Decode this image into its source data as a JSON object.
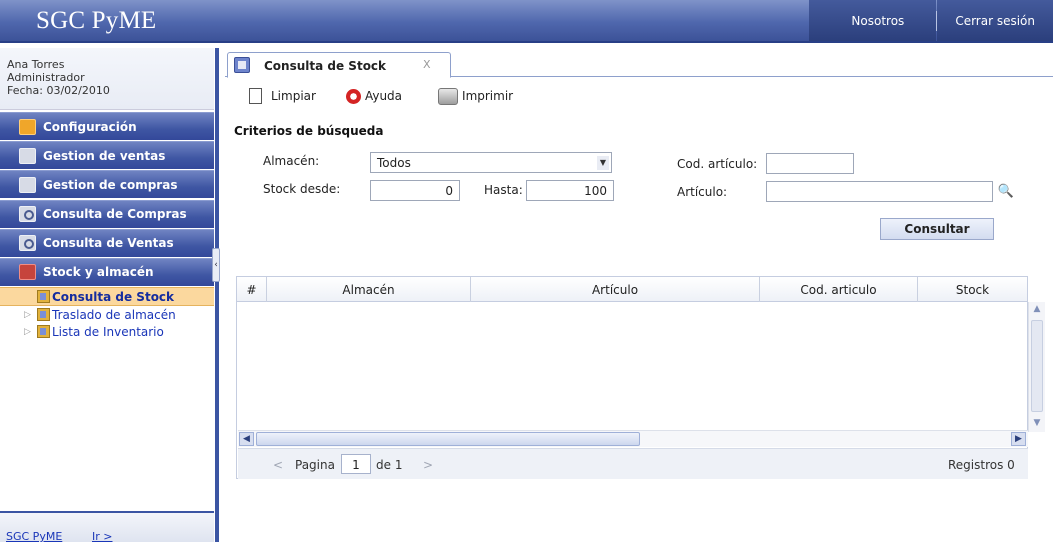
{
  "header": {
    "app_title": "SGC PyME",
    "links": [
      "Nosotros",
      "Cerrar sesión"
    ]
  },
  "sidebar": {
    "user_name": "Ana Torres",
    "user_role": "Administrador",
    "date_line": "Fecha: 03/02/2010",
    "menu": [
      {
        "label": "Configuración",
        "icon": "settings-icon"
      },
      {
        "label": "Gestion de ventas",
        "icon": "folder-icon"
      },
      {
        "label": "Gestion de compras",
        "icon": "folder-icon"
      },
      {
        "label": "Consulta de Compras",
        "icon": "search-icon"
      },
      {
        "label": "Consulta de Ventas",
        "icon": "search-icon"
      },
      {
        "label": "Stock y almacén",
        "icon": "warehouse-icon"
      }
    ],
    "submenu": [
      {
        "label": "Consulta de Stock",
        "active": true
      },
      {
        "label": "Traslado de almacén",
        "active": false
      },
      {
        "label": "Lista de Inventario",
        "active": false
      }
    ],
    "footer_app": "SGC PyME",
    "footer_go": "Ir >"
  },
  "tab": {
    "title": "Consulta de Stock",
    "close": "X"
  },
  "toolbar": {
    "clear": "Limpiar",
    "help": "Ayuda",
    "print": "Imprimir"
  },
  "criteria": {
    "title": "Criterios de búsqueda",
    "warehouse_label": "Almacén:",
    "warehouse_value": "Todos",
    "stock_from_label": "Stock desde:",
    "stock_from_value": "0",
    "to_label": "Hasta:",
    "to_value": "100",
    "item_code_label": "Cod. artículo:",
    "item_code_value": "",
    "item_label": "Artículo:",
    "item_value": "",
    "submit": "Consultar"
  },
  "grid": {
    "columns": [
      "#",
      "Almacén",
      "Artículo",
      "Cod. articulo",
      "Stock"
    ],
    "rows": []
  },
  "pager": {
    "prev": "<",
    "page_label": "Pagina",
    "page_value": "1",
    "of_label": "de 1",
    "next": ">",
    "records": "Registros 0"
  },
  "colors": {
    "header_blue": "#4f67ad",
    "menu_blue": "#3f56a3",
    "active_item": "#fbd89e",
    "link_blue": "#1a36b8"
  }
}
